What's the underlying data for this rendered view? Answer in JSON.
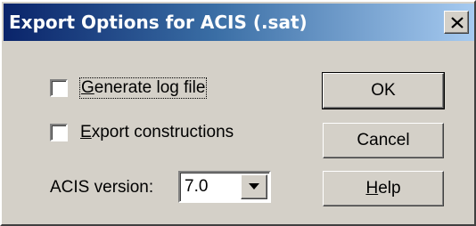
{
  "window": {
    "title": "Export Options for ACIS (.sat)",
    "close_icon": "close-icon"
  },
  "options": {
    "generate_log": {
      "label_mnemonic": "G",
      "label_rest": "enerate log file",
      "checked": false
    },
    "export_constructions": {
      "label_mnemonic": "E",
      "label_rest": "xport constructions",
      "checked": false
    },
    "acis_version": {
      "label": "ACIS version:",
      "value": "7.0"
    }
  },
  "buttons": {
    "ok": "OK",
    "cancel": "Cancel",
    "help_mnemonic": "H",
    "help_rest": "elp"
  },
  "colors": {
    "title_start": "#0a246a",
    "title_end": "#a6caf0",
    "face": "#d4d0c8"
  }
}
